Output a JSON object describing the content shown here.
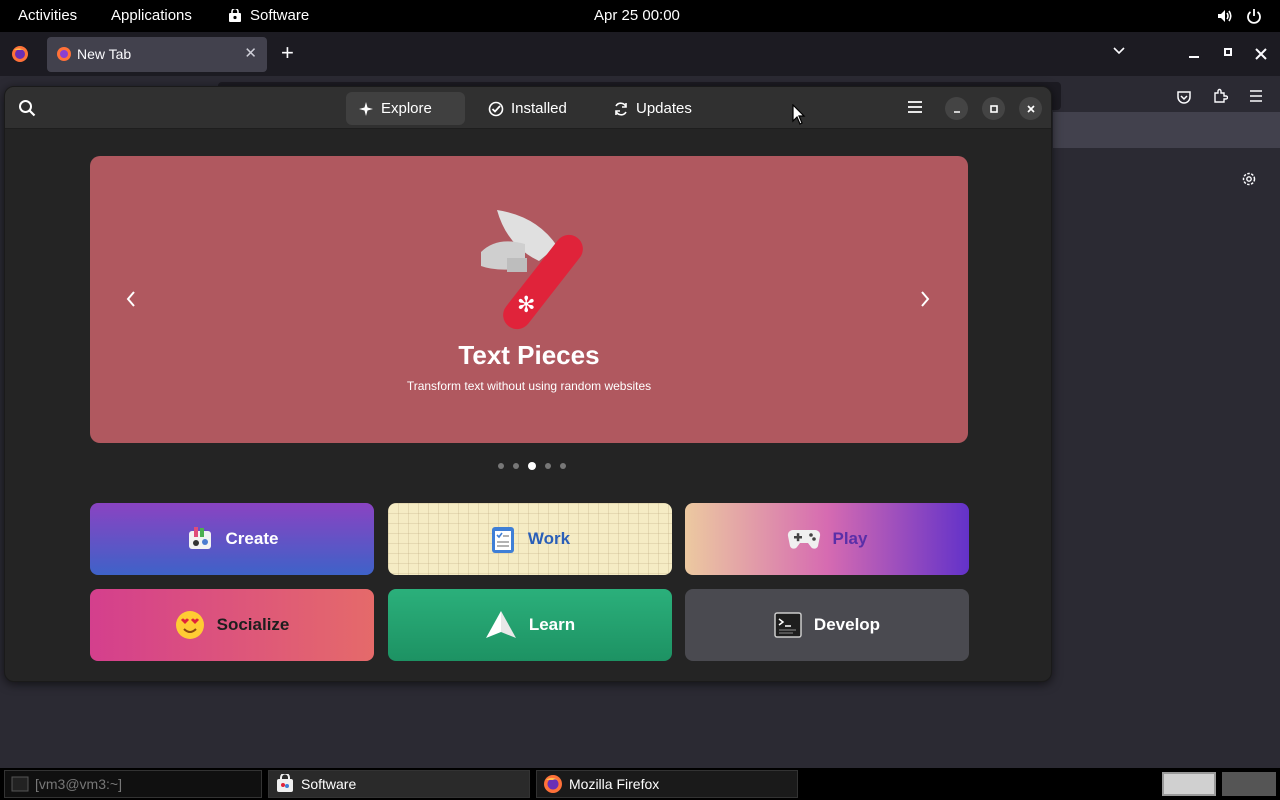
{
  "topbar": {
    "activities": "Activities",
    "applications": "Applications",
    "software": "Software",
    "clock": "Apr 25  00:00"
  },
  "firefox": {
    "tab_title": "New Tab",
    "new_tab_symbol": "+",
    "close_symbol": "✕"
  },
  "software": {
    "tabs": [
      {
        "label": "Explore",
        "active": true
      },
      {
        "label": "Installed",
        "active": false
      },
      {
        "label": "Updates",
        "active": false
      }
    ],
    "banner": {
      "title": "Text Pieces",
      "subtitle": "Transform text without using random websites",
      "background": "#b0585f",
      "pages": 5,
      "current_page": 3
    },
    "categories": [
      {
        "label": "Create"
      },
      {
        "label": "Work"
      },
      {
        "label": "Play"
      },
      {
        "label": "Socialize"
      },
      {
        "label": "Learn"
      },
      {
        "label": "Develop"
      }
    ]
  },
  "taskbar": {
    "terminal": "[vm3@vm3:~]",
    "software": "Software",
    "firefox": "Mozilla Firefox"
  }
}
